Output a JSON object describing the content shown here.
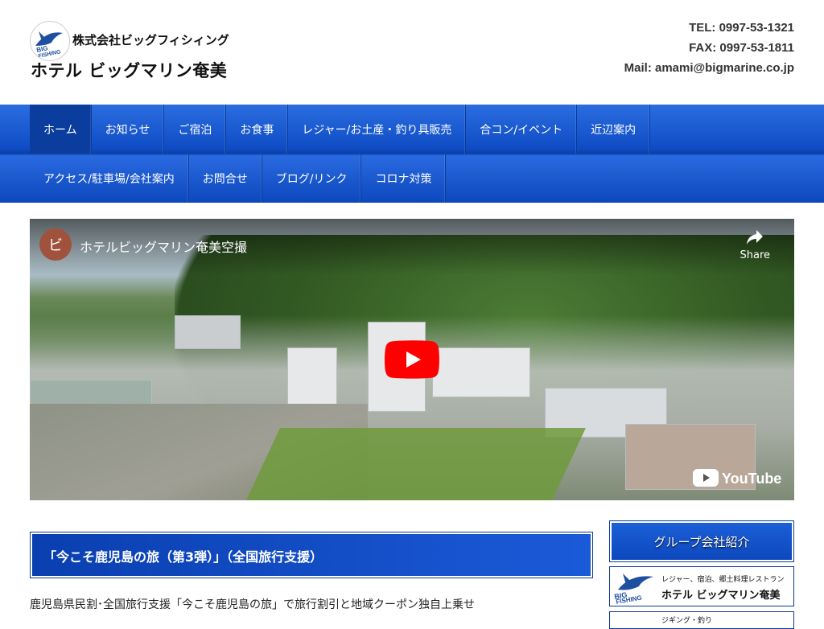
{
  "header": {
    "company": "株式会社ビッグフィシィング",
    "site_title": "ホテル ビッグマリン奄美",
    "tel": "TEL: 0997-53-1321",
    "fax": "FAX: 0997-53-1811",
    "mail": "Mail: amami@bigmarine.co.jp",
    "logo_text": "BIG FISHING"
  },
  "nav": {
    "row1": [
      "ホーム",
      "お知らせ",
      "ご宿泊",
      "お食事",
      "レジャー/お土産・釣り具販売",
      "合コン/イベント",
      "近辺案内"
    ],
    "row2": [
      "アクセス/駐車場/会社案内",
      "お問合せ",
      "ブログ/リンク",
      "コロナ対策"
    ],
    "active": "ホーム"
  },
  "video": {
    "channel_initial": "ビ",
    "title": "ホテルビッグマリン奄美空撮",
    "share_label": "Share",
    "brand": "YouTube"
  },
  "post": {
    "title": "「今こそ鹿児島の旅（第3弾）」（全国旅行支援）",
    "text": "鹿児島県民割･全国旅行支援「今こそ鹿児島の旅」で旅行割引と地域クーポン独自上乗せ"
  },
  "sidebar": {
    "heading": "グループ会社紹介",
    "banner1_sub": "レジャー、宿泊、郷土料理レストラン",
    "banner1_name": "ホテル ビッグマリン奄美",
    "banner2_sub": "ジギング・釣り"
  },
  "colors": {
    "nav_blue": "#0f4cc4",
    "nav_active": "#0a3d9e",
    "youtube_red": "#ff0000"
  }
}
